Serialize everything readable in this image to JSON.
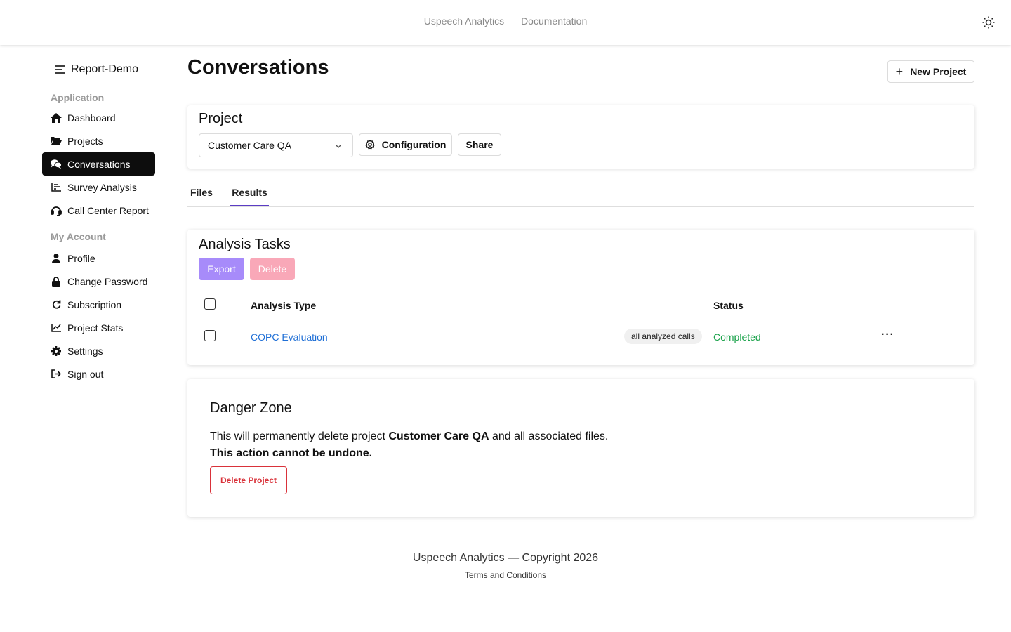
{
  "topbar": {
    "links": [
      "Uspeech Analytics",
      "Documentation"
    ],
    "theme_icon": "sun-icon"
  },
  "sidebar": {
    "brand": "Report-Demo",
    "sections": [
      {
        "label": "Application",
        "items": [
          {
            "label": "Dashboard",
            "icon": "home-icon"
          },
          {
            "label": "Projects",
            "icon": "folder-open-icon"
          },
          {
            "label": "Conversations",
            "icon": "comments-icon",
            "active": true
          },
          {
            "label": "Survey Analysis",
            "icon": "bar-chart-icon"
          },
          {
            "label": "Call Center Report",
            "icon": "headset-icon"
          }
        ]
      },
      {
        "label": "My Account",
        "items": [
          {
            "label": "Profile",
            "icon": "user-icon"
          },
          {
            "label": "Change Password",
            "icon": "lock-icon"
          },
          {
            "label": "Subscription",
            "icon": "refresh-icon"
          },
          {
            "label": "Project Stats",
            "icon": "line-chart-icon"
          },
          {
            "label": "Settings",
            "icon": "gear-icon"
          },
          {
            "label": "Sign out",
            "icon": "sign-out-icon"
          }
        ]
      }
    ]
  },
  "main": {
    "title": "Conversations",
    "new_project_label": "New Project",
    "project_card": {
      "title": "Project",
      "selected_project": "Customer Care QA",
      "configuration_label": "Configuration",
      "share_label": "Share"
    },
    "tabs": [
      {
        "label": "Files",
        "active": false
      },
      {
        "label": "Results",
        "active": true
      }
    ],
    "tasks_card": {
      "title": "Analysis Tasks",
      "export_label": "Export",
      "delete_label": "Delete",
      "columns": [
        "Analysis Type",
        "Status"
      ],
      "rows": [
        {
          "analysis_type": "COPC Evaluation",
          "scope": "all analyzed calls",
          "status": "Completed"
        }
      ]
    },
    "danger_zone": {
      "title": "Danger Zone",
      "text_prefix": "This will permanently delete project ",
      "project_name": "Customer Care QA",
      "text_suffix": " and all associated files.",
      "warning": "This action cannot be undone.",
      "button_label": "Delete Project"
    }
  },
  "footer": {
    "copyright": "Uspeech Analytics — Copyright 2026",
    "terms": "Terms and Conditions"
  },
  "colors": {
    "accent": "#5b3cc4",
    "export_button": "#a78bfa",
    "delete_button": "#f9a8b8",
    "danger": "#d9323a",
    "link": "#1f6fd6",
    "success": "#1aa24a"
  }
}
